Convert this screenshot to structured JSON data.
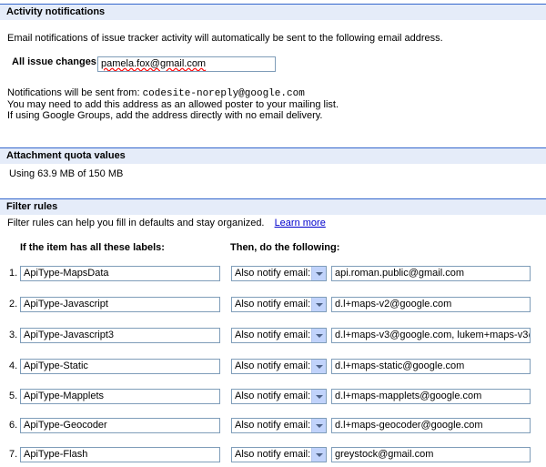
{
  "activity": {
    "heading": "Activity notifications",
    "intro": "Email notifications of issue tracker activity will automatically be sent to the following email address.",
    "all_issue_label": "All issue changes:",
    "email_value": "pamela.fox@gmail.com",
    "sent_from_prefix": "Notifications will be sent from:",
    "sent_from_address": "codesite-noreply@google.com",
    "allowed_poster_note": "You may need to add this address as an allowed poster to your mailing list.",
    "groups_note": "If using Google Groups, add the address directly with no email delivery."
  },
  "quota": {
    "heading": "Attachment quota values",
    "usage": "Using 63.9 MB of 150 MB"
  },
  "filters": {
    "heading": "Filter rules",
    "description": "Filter rules can help you fill in defaults and stay organized.",
    "learn_more": "Learn more",
    "col_labels": "If the item has all these labels:",
    "col_actions": "Then, do the following:",
    "rules": [
      {
        "num": "1.",
        "label": "ApiType-MapsData",
        "action": "Also notify email:",
        "value": "api.roman.public@gmail.com"
      },
      {
        "num": "2.",
        "label": "ApiType-Javascript",
        "action": "Also notify email:",
        "value": "d.l+maps-v2@google.com"
      },
      {
        "num": "3.",
        "label": "ApiType-Javascript3",
        "action": "Also notify email:",
        "value": "d.l+maps-v3@google.com, lukem+maps-v3@g"
      },
      {
        "num": "4.",
        "label": "ApiType-Static",
        "action": "Also notify email:",
        "value": "d.l+maps-static@google.com"
      },
      {
        "num": "5.",
        "label": "ApiType-Mapplets",
        "action": "Also notify email:",
        "value": "d.l+maps-mapplets@google.com"
      },
      {
        "num": "6.",
        "label": "ApiType-Geocoder",
        "action": "Also notify email:",
        "value": "d.l+maps-geocoder@google.com"
      },
      {
        "num": "7.",
        "label": "ApiType-Flash",
        "action": "Also notify email:",
        "value": "greystock@gmail.com"
      }
    ]
  }
}
